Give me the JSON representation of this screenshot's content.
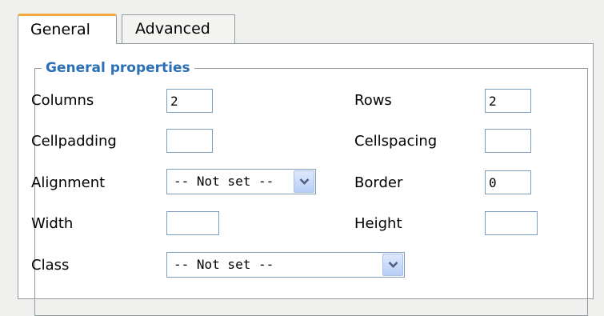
{
  "tabs": [
    {
      "label": "General",
      "active": true
    },
    {
      "label": "Advanced",
      "active": false
    }
  ],
  "general_properties": {
    "legend": "General properties",
    "columns": {
      "label": "Columns",
      "value": "2"
    },
    "rows": {
      "label": "Rows",
      "value": "2"
    },
    "cellpadding": {
      "label": "Cellpadding",
      "value": ""
    },
    "cellspacing": {
      "label": "Cellspacing",
      "value": ""
    },
    "alignment": {
      "label": "Alignment",
      "value": "-- Not set --"
    },
    "border": {
      "label": "Border",
      "value": "0"
    },
    "width": {
      "label": "Width",
      "value": ""
    },
    "height": {
      "label": "Height",
      "value": ""
    },
    "class": {
      "label": "Class",
      "value": "-- Not set --"
    }
  },
  "icons": {
    "dropdown_arrow": "chevron-down-icon"
  },
  "colors": {
    "legend": "#2b6fb6",
    "active_tab_accent": "#f2a93b",
    "input_border": "#7f9db9"
  }
}
